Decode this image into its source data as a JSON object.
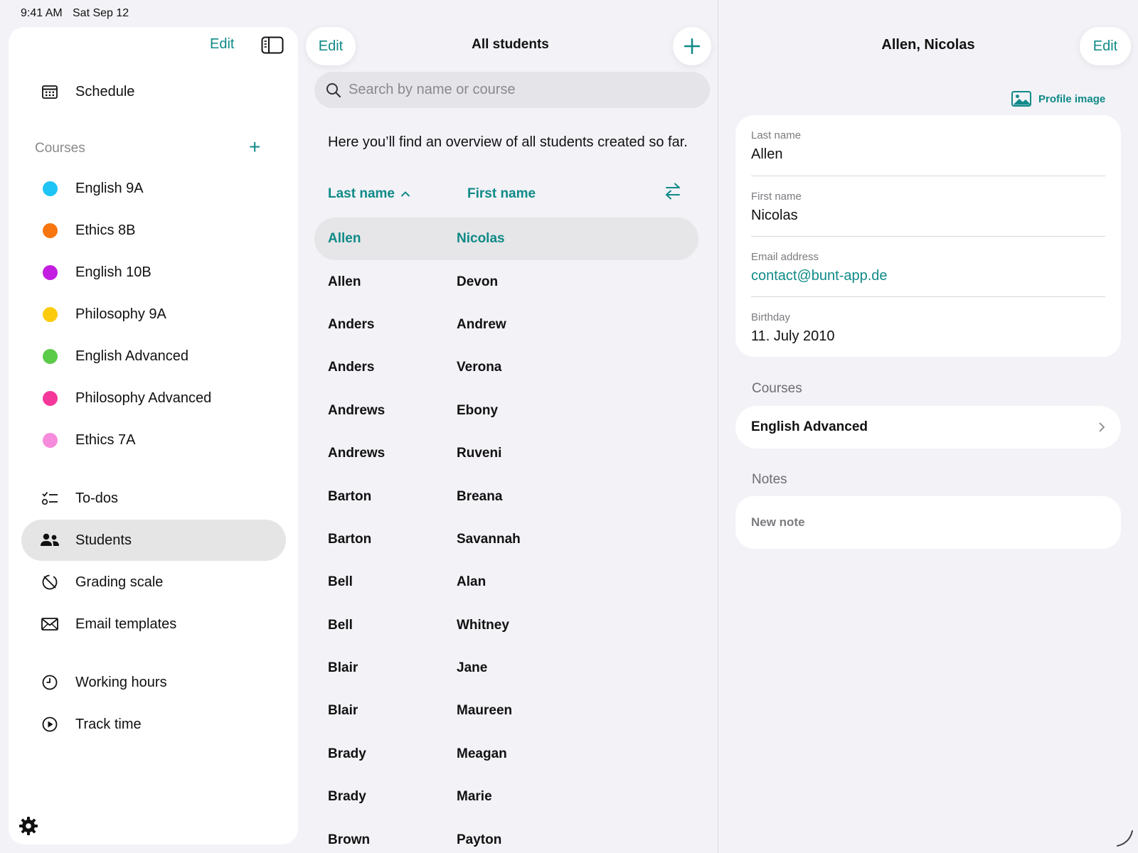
{
  "status_bar": {
    "time": "9:41 AM",
    "date": "Sat Sep 12"
  },
  "sidebar": {
    "edit_label": "Edit",
    "schedule_label": "Schedule",
    "courses_header": "Courses",
    "courses": [
      {
        "label": "English 9A",
        "color": "#1ec4f5"
      },
      {
        "label": "Ethics 8B",
        "color": "#f7760f"
      },
      {
        "label": "English 10B",
        "color": "#c21de0"
      },
      {
        "label": "Philosophy 9A",
        "color": "#fccb0d"
      },
      {
        "label": "English Advanced",
        "color": "#5ccb4a"
      },
      {
        "label": "Philosophy Advanced",
        "color": "#f5379a"
      },
      {
        "label": "Ethics 7A",
        "color": "#f78bdc"
      }
    ],
    "nav": {
      "todos": "To-dos",
      "students": "Students",
      "grading_scale": "Grading scale",
      "email_templates": "Email templates",
      "working_hours": "Working hours",
      "track_time": "Track time"
    },
    "selected": "Students"
  },
  "student_list": {
    "edit_label": "Edit",
    "title": "All students",
    "search_placeholder": "Search by name or course",
    "intro": "Here you’ll find an overview of all students created so far.",
    "col_last": "Last name",
    "col_first": "First name",
    "rows": [
      {
        "last": "Allen",
        "first": "Nicolas",
        "selected": true
      },
      {
        "last": "Allen",
        "first": "Devon"
      },
      {
        "last": "Anders",
        "first": "Andrew"
      },
      {
        "last": "Anders",
        "first": "Verona"
      },
      {
        "last": "Andrews",
        "first": "Ebony"
      },
      {
        "last": "Andrews",
        "first": "Ruveni"
      },
      {
        "last": "Barton",
        "first": "Breana"
      },
      {
        "last": "Barton",
        "first": "Savannah"
      },
      {
        "last": "Bell",
        "first": "Alan"
      },
      {
        "last": "Bell",
        "first": "Whitney"
      },
      {
        "last": "Blair",
        "first": "Jane"
      },
      {
        "last": "Blair",
        "first": "Maureen"
      },
      {
        "last": "Brady",
        "first": "Meagan"
      },
      {
        "last": "Brady",
        "first": "Marie"
      },
      {
        "last": "Brown",
        "first": "Payton"
      }
    ]
  },
  "detail": {
    "title": "Allen, Nicolas",
    "edit_label": "Edit",
    "profile_image_label": "Profile image",
    "fields": {
      "last_name_label": "Last name",
      "last_name": "Allen",
      "first_name_label": "First name",
      "first_name": "Nicolas",
      "email_label": "Email address",
      "email": "contact@bunt-app.de",
      "birthday_label": "Birthday",
      "birthday": "11. July 2010"
    },
    "courses_label": "Courses",
    "courses": [
      "English Advanced"
    ],
    "notes_label": "Notes",
    "new_note_label": "New note"
  },
  "accent_color": "#0f8a87"
}
